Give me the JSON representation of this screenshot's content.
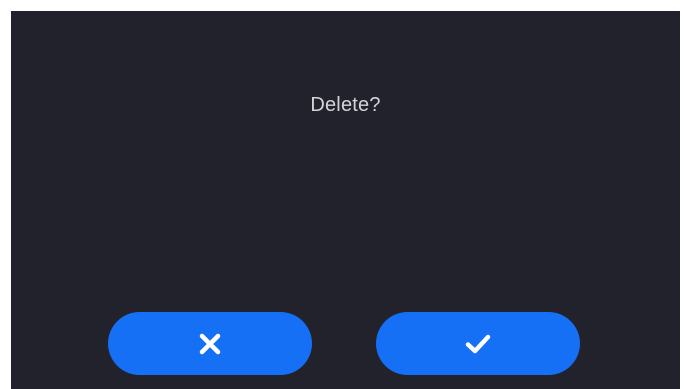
{
  "dialog": {
    "prompt": "Delete?",
    "buttons": {
      "cancel": {
        "icon": "close-icon"
      },
      "confirm": {
        "icon": "check-icon"
      }
    }
  },
  "colors": {
    "background": "#22222c",
    "button": "#1570f5",
    "text": "#d4d4d8",
    "icon": "#ffffff"
  }
}
